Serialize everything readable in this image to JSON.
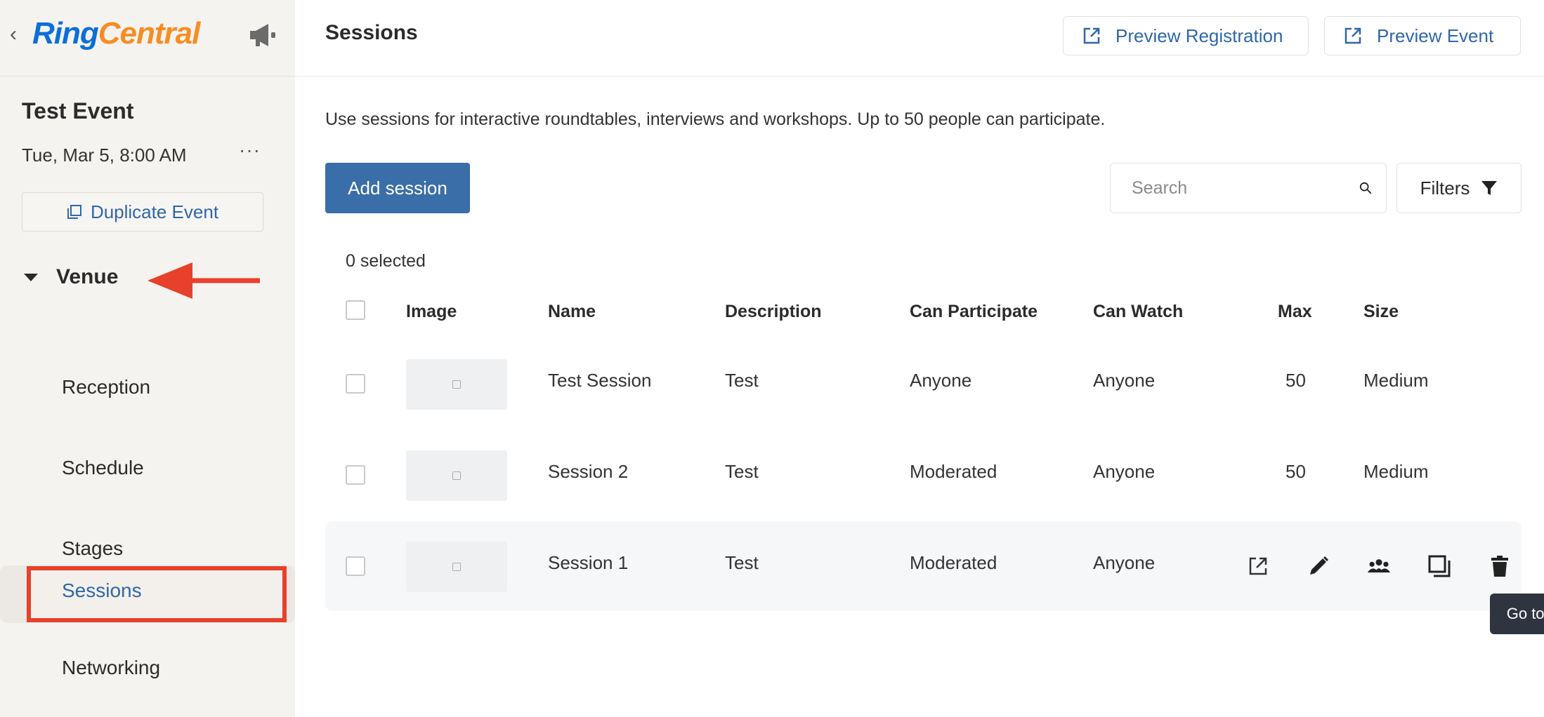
{
  "sidebar": {
    "logo": {
      "ring": "Ring",
      "central": "Central"
    },
    "event_title": "Test Event",
    "event_date": "Tue, Mar 5, 8:00 AM",
    "more": "···",
    "duplicate_label": "Duplicate Event",
    "venue_label": "Venue",
    "items": [
      {
        "label": "Reception"
      },
      {
        "label": "Schedule"
      },
      {
        "label": "Stages"
      },
      {
        "label": "Sessions",
        "active": true
      },
      {
        "label": "Networking"
      }
    ]
  },
  "header": {
    "title": "Sessions",
    "preview_registration": "Preview Registration",
    "preview_event": "Preview Event"
  },
  "main": {
    "description": "Use sessions for interactive roundtables, interviews and workshops. Up to 50 people can participate.",
    "add_session": "Add session",
    "search_placeholder": "Search",
    "filters": "Filters",
    "selected_count": "0 selected"
  },
  "table": {
    "headers": {
      "image": "Image",
      "name": "Name",
      "description": "Description",
      "can_participate": "Can Participate",
      "can_watch": "Can Watch",
      "max": "Max",
      "size": "Size"
    },
    "rows": [
      {
        "name": "Test Session",
        "description": "Test",
        "can_participate": "Anyone",
        "can_watch": "Anyone",
        "max": "50",
        "size": "Medium"
      },
      {
        "name": "Session 2",
        "description": "Test",
        "can_participate": "Moderated",
        "can_watch": "Anyone",
        "max": "50",
        "size": "Medium"
      },
      {
        "name": "Session 1",
        "description": "Test",
        "can_participate": "Moderated",
        "can_watch": "Anyone",
        "max": "",
        "size": ""
      }
    ]
  },
  "tooltip": "Go to session",
  "colors": {
    "accent": "#3a6ea8",
    "link": "#2f67a8",
    "highlight": "#e8402a",
    "sidebar_bg": "#f5f3f0"
  },
  "icons": [
    "back-chevron-icon",
    "megaphone-icon",
    "copy-icon",
    "external-link-icon",
    "search-icon",
    "filter-icon",
    "pencil-icon",
    "people-icon",
    "duplicate-icon",
    "trash-icon"
  ]
}
